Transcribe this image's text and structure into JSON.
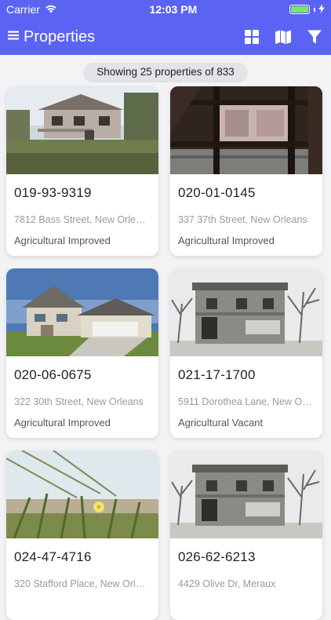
{
  "status_bar": {
    "carrier": "Carrier",
    "time": "12:03 PM"
  },
  "navbar": {
    "title": "Properties",
    "icons": [
      "menu-icon",
      "grid-view-icon",
      "map-icon",
      "filter-icon"
    ]
  },
  "summary": {
    "text": "Showing 25 properties of 833"
  },
  "colors": {
    "accent": "#5b63f2",
    "battery": "#7ce36b",
    "background": "#f3f3f6"
  },
  "properties": [
    {
      "id": "019-93-9319",
      "address": "7812 Bass Street, New Orleans",
      "type": "Agricultural Improved"
    },
    {
      "id": "020-01-0145",
      "address": "337 37th Street, New Orleans",
      "type": "Agricultural Improved"
    },
    {
      "id": "020-06-0675",
      "address": "322 30th Street, New Orleans",
      "type": "Agricultural Improved"
    },
    {
      "id": "021-17-1700",
      "address": "5911 Dorothea Lane, New Orleans",
      "type": "Agricultural Vacant"
    },
    {
      "id": "024-47-4716",
      "address": "320 Stafford Place, New Orleans",
      "type": ""
    },
    {
      "id": "026-62-6213",
      "address": "4429 Olive Dr, Meraux",
      "type": ""
    }
  ]
}
